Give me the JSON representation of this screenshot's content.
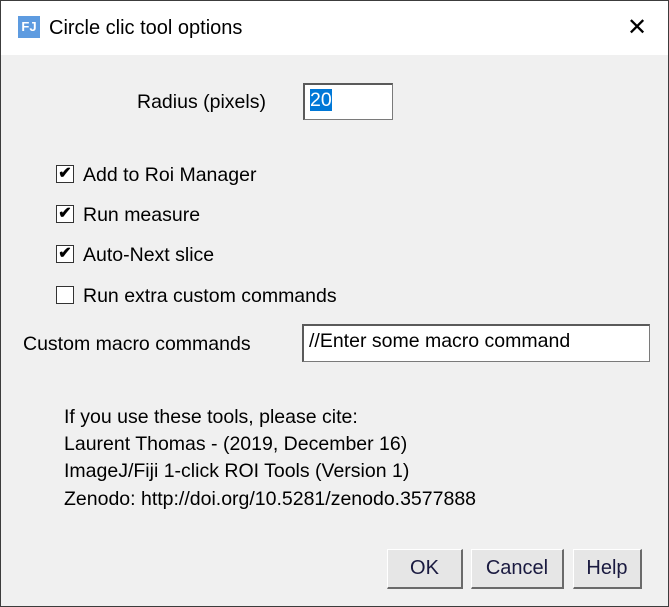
{
  "window": {
    "title": "Circle clic tool options",
    "icon": "fiji-icon",
    "close_symbol": "✕"
  },
  "radius": {
    "label": "Radius (pixels)",
    "value": "20"
  },
  "checkboxes": [
    {
      "label": "Add to Roi Manager",
      "checked": true
    },
    {
      "label": "Run measure",
      "checked": true
    },
    {
      "label": "Auto-Next slice",
      "checked": true
    },
    {
      "label": "Run extra custom commands",
      "checked": false
    }
  ],
  "macro": {
    "label": "Custom macro commands",
    "value": "//Enter some macro command"
  },
  "citation": [
    "If you use these tools, please cite:",
    "Laurent Thomas - (2019, December 16)",
    "ImageJ/Fiji 1-click ROI Tools (Version 1)",
    "Zenodo: http://doi.org/10.5281/zenodo.3577888"
  ],
  "buttons": {
    "ok": "OK",
    "cancel": "Cancel",
    "help": "Help"
  },
  "check_symbol": "✔"
}
